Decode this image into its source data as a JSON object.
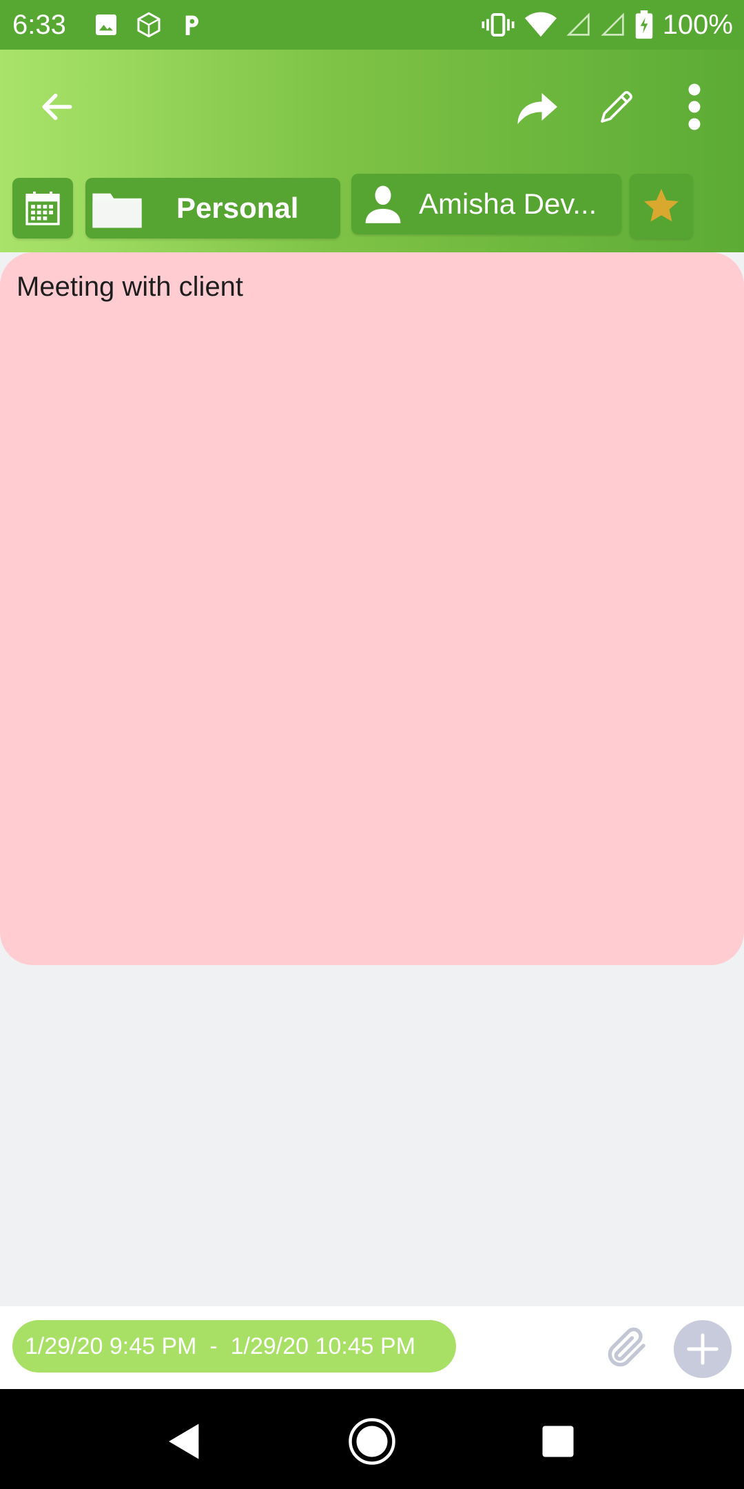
{
  "status_bar": {
    "time": "6:33",
    "battery": "100%",
    "icons": [
      "image-icon",
      "box-icon",
      "p-icon",
      "vibrate-icon",
      "wifi-icon",
      "signal-icon",
      "signal-icon",
      "battery-charging-icon"
    ]
  },
  "toolbar": {
    "back_icon": "arrow-left-icon",
    "share_icon": "share-icon",
    "edit_icon": "pencil-icon",
    "more_icon": "more-vert-icon"
  },
  "chips": {
    "calendar_icon": "calendar-icon",
    "folder_label": "Personal",
    "contact_label": "Amisha Dev...",
    "favorite_icon": "star-icon"
  },
  "note": {
    "text": "Meeting with client",
    "background": "#ffccd2"
  },
  "bottom": {
    "date_range": "1/29/20 9:45 PM  -  1/29/20 10:45 PM",
    "attach_icon": "paperclip-icon",
    "add_icon": "plus-icon"
  },
  "colors": {
    "status_bar": "#57a832",
    "chip": "#56a432",
    "date_pill": "#a7e065",
    "star": "#d9a82e"
  }
}
